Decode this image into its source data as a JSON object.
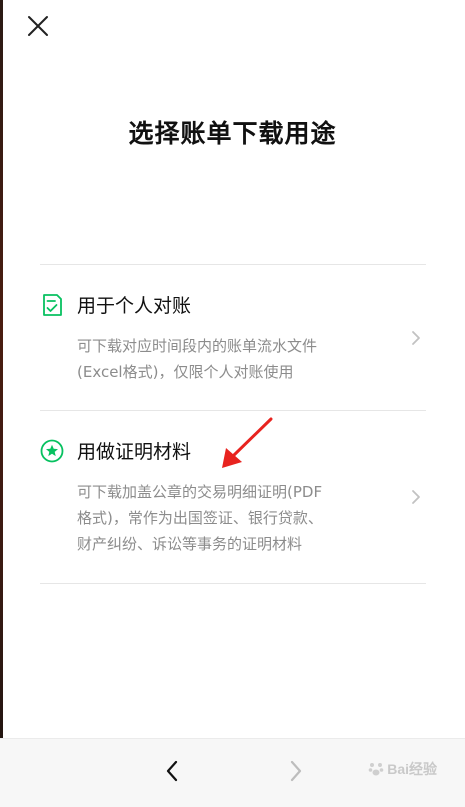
{
  "header": {
    "close_icon": "close-icon",
    "title": "选择账单下载用途"
  },
  "options": [
    {
      "icon": "checklist-document-icon",
      "title": "用于个人对账",
      "desc_lines": [
        "可下载对应时间段内的账单流水文件",
        "(Excel格式)，仅限个人对账使用"
      ]
    },
    {
      "icon": "star-badge-icon",
      "title": "用做证明材料",
      "desc_lines": [
        "可下载加盖公章的交易明细证明(PDF",
        "格式)，常作为出国签证、银行贷款、",
        "财产纠纷、诉讼等事务的证明材料"
      ]
    }
  ],
  "colors": {
    "accent": "#07c160",
    "text_primary": "#111111",
    "text_secondary": "#8c8c8c",
    "divider": "#e6e6e6",
    "annotation_arrow": "#e8231f"
  },
  "footer": {
    "back_icon": "chevron-left-icon",
    "forward_icon": "chevron-right-icon",
    "watermark": "Bai经验"
  }
}
